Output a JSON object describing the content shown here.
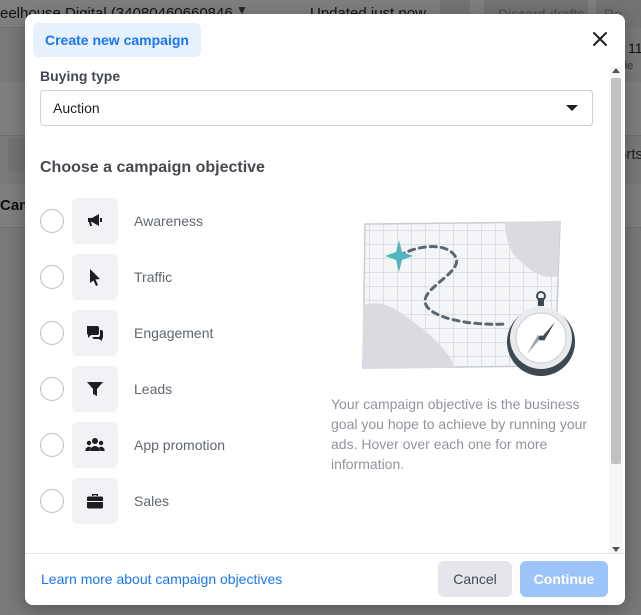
{
  "background": {
    "account_name": "eelhouse Digital (34080460660846",
    "updated_status": "Updated just now",
    "discard_label": "Discard drafts",
    "review_label": "Re",
    "side_number": "11",
    "side_subtext": "de",
    "side_tab_label": "orts",
    "campaigns_label": "Cam"
  },
  "modal": {
    "header_tab": "Create new campaign",
    "buying_type": {
      "label": "Buying type",
      "value": "Auction"
    },
    "objective_title": "Choose a campaign objective",
    "objectives": [
      {
        "label": "Awareness",
        "icon": "megaphone-icon"
      },
      {
        "label": "Traffic",
        "icon": "cursor-icon"
      },
      {
        "label": "Engagement",
        "icon": "chat-bubbles-icon"
      },
      {
        "label": "Leads",
        "icon": "funnel-icon"
      },
      {
        "label": "App promotion",
        "icon": "people-icon"
      },
      {
        "label": "Sales",
        "icon": "briefcase-icon"
      }
    ],
    "description": "Your campaign objective is the business goal you hope to achieve by running your ads. Hover over each one for more information.",
    "footer": {
      "learn_more": "Learn more about campaign objectives",
      "cancel": "Cancel",
      "continue": "Continue"
    }
  },
  "colors": {
    "accent": "#1877f2",
    "header_tab_bg": "#e7f0fd",
    "continue_disabled": "#9cc4f8",
    "illustration_teal": "#4fb7c0"
  }
}
